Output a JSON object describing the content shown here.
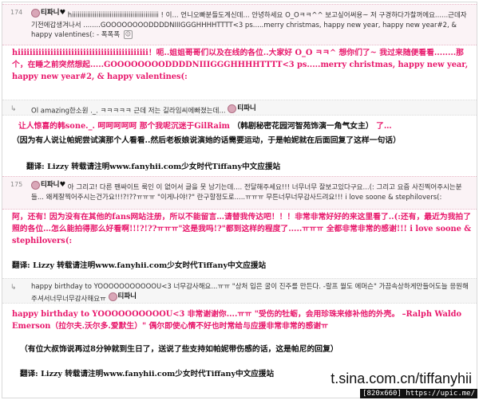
{
  "posts": [
    {
      "num": "174",
      "user": "티파니♥",
      "text": "hiiiiiiiiiiiiiiiiiiiiiiiiiiiiiiiiiiiiiiiiiiiiii ! 이... 언니오빠분들도계신데... 안녕하세요 O_Oㅋㅋ^^ 보고싶어써용~ 저 구경하다가찰꺼에요......근데자기전에갑생겨나서 ........GOOOOOOOODDDDNIIIGGGHHHHTTTT<3 ps.....merry christmas, happy new year, happy new year#2, & happy valentines(: - 폭폭폭"
    },
    {
      "text": "Ol amazing한소원 ._. ㅋㅋㅋㅋㅋ 근데 저는 길라임씨에빠졌는데... ",
      "user": "티파니"
    },
    {
      "num": "175",
      "user": "티파니♥",
      "text": "아 그리고! 다른 팬싸이트 룩인 이 없어서 글을 못 남기는데.... 전달해주세요!!! 너무너무 잘보고있다구요...(: 그리고 요즘 사진찍어주시는분들... 왜케잘찍어주시는건가요!!!?!??ㅠㅠㅠ \"이게나야!?\" 란구할정도로.....ㅠㅠㅠ 무튼너무너무감사드려요!!! i love soone & stephilovers(: "
    },
    {
      "text": "happy birthday to YOOOOOOOOOOOU<3 너무감사해요...ㅠㅠ \"상처 입은 굴이 진주를 만든다. -랄프 월도 에머슨\" 가끔속상하게만들어도늘 응원해주셔서너무너무감사해요ㅠ",
      "user": "티파니"
    }
  ],
  "zh1": "hiiiiiiiiiiiiiiiiiiiiiiiiiiiiiiiiiiiiiiiiiiii！呃..姐姐哥哥们以及在线的各位..大家好 O_O ㅋㅋ^ 想你们了~ 我过来随便看看........那个，在睡之前突然想起.....GOOOOOOOODDDDNIIIGGGHHHHTTTT<3 ps.....merry christmas, happy new year, happy new year#2, & happy valentines(:",
  "zh2a": "让人惊喜的韩sone._. 呵呵呵呵呵 那个我呢沉迷于GilRaim",
  "zh2b": "（韩剧秘密花园河智苑饰演一角气女主）",
  "zh2c": "了…",
  "zh2d": "（因为有人说让帕妮尝试演那个人看看..然后老板娘说演她的话需要运动，于是帕妮就在后面回复了这样一句话）",
  "credit": "翻译: Lizzy  转载请注明www.fanyhii.com少女时代Tiffany中文应援站",
  "zh3": "阿，还有! 因为没有在其他的fans网站注册，所以不能留言…请替我传达吧！！！非常非常好好的来这里看了..(:还有，最近为我拍了照的各位…怎么能拍得那么好看啊!!!?!??ㅠㅠㅠ\"这是我吗!?\"都到这样的程度了.....ㅠㅠㅠ 全都非常非常的感谢!!!    i love soone & stephilovers(:",
  "zh4a": "happy birthday to YOOOOOOOOOOU<3 非常谢谢你....ㅠㅠ \"受伤的牡蛎，会用珍珠来修补他的外壳。 –Ralph Waldo Emerson（拉尔夫.沃尔多.爱默生）\" 偶尔即使心情不好也时常给与应援非常非常的感谢ㅠ",
  "zh4b": "（有位大叔饰说再过8分钟就到生日了，送说了些支持如帕妮带伤感的话，这是帕尼的回复）",
  "watermark": "t.sina.com.cn/tiffanyhii",
  "badge": "[820x660] https://upic.me/"
}
